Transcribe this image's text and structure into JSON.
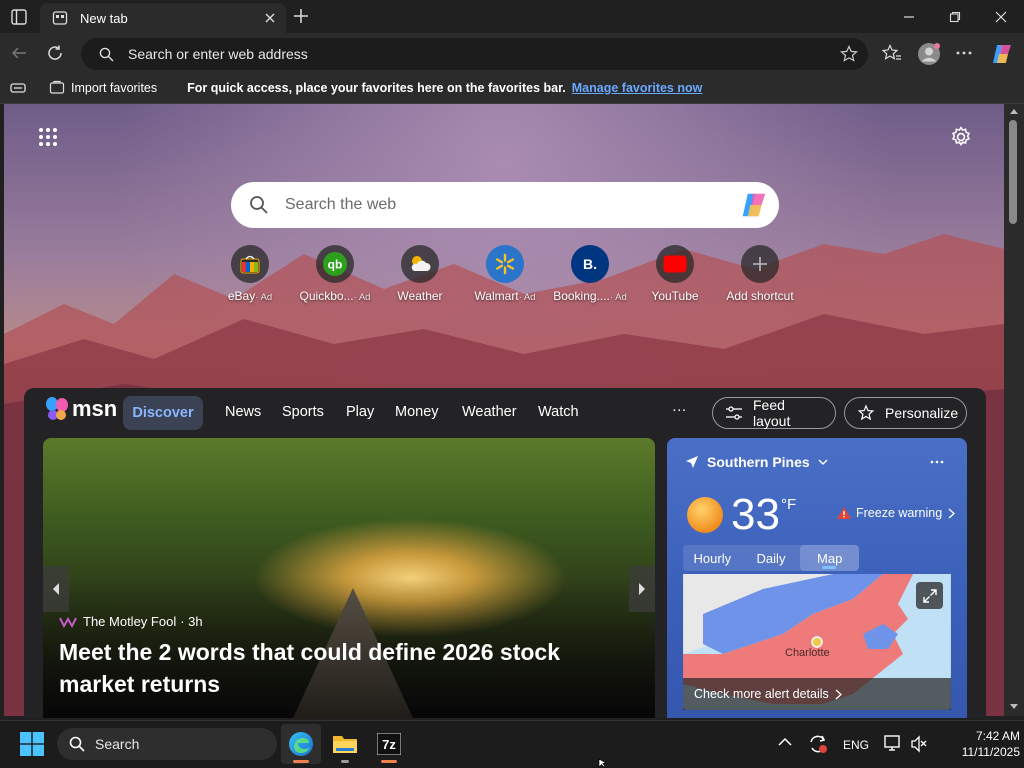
{
  "browser": {
    "tab_title": "New tab",
    "address_placeholder": "Search or enter web address"
  },
  "favorites_bar": {
    "import_label": "Import favorites",
    "hint": "For quick access, place your favorites here on the favorites bar.",
    "manage_link": "Manage favorites now"
  },
  "newtab": {
    "search_placeholder": "Search the web",
    "shortcuts": [
      {
        "label": "eBay",
        "ad": "· Ad",
        "icon": "ebay-icon"
      },
      {
        "label": "Quickbo...",
        "ad": "· Ad",
        "icon": "quickbooks-icon"
      },
      {
        "label": "Weather",
        "ad": "",
        "icon": "weather-icon"
      },
      {
        "label": "Walmart",
        "ad": "· Ad",
        "icon": "walmart-icon"
      },
      {
        "label": "Booking....",
        "ad": "· Ad",
        "icon": "booking-icon"
      },
      {
        "label": "YouTube",
        "ad": "",
        "icon": "youtube-icon"
      },
      {
        "label": "Add shortcut",
        "ad": "",
        "icon": "plus-icon"
      }
    ]
  },
  "msn": {
    "logo": "msn",
    "nav": [
      "Discover",
      "News",
      "Sports",
      "Play",
      "Money",
      "Weather",
      "Watch"
    ],
    "more": "···",
    "feed_layout": "Feed layout",
    "personalize": "Personalize"
  },
  "hero": {
    "source": "The Motley Fool",
    "age": "· 3h",
    "headline": "Meet the 2 words that could define 2026 stock market returns"
  },
  "weather": {
    "location": "Southern Pines",
    "temp": "33",
    "unit": "°F",
    "alert": "Freeze warning",
    "tabs": [
      "Hourly",
      "Daily",
      "Map"
    ],
    "map_city": "Charlotte",
    "footer": "Check more alert details"
  },
  "taskbar": {
    "search": "Search",
    "lang": "ENG",
    "time": "7:42 AM",
    "date": "11/11/2025"
  },
  "colors": {
    "accent": "#8ab6ff",
    "link": "#6aa9ff",
    "weather_card": "#3a5fb9",
    "alert_red": "#e0433a"
  }
}
